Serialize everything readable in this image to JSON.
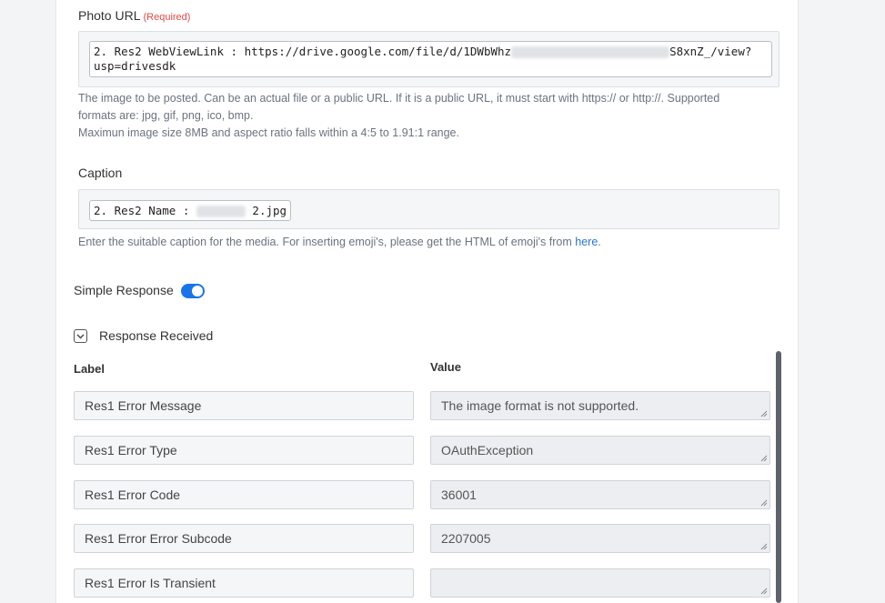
{
  "photo_url": {
    "label": "Photo URL",
    "required": "(Required)",
    "token_line1_a": "2. Res2 WebViewLink : https://drive.google.com/file/d/1DWbWhz",
    "token_line1_b": "S8xnZ_/view?",
    "token_line2": "usp=drivesdk",
    "help_line1": "The image to be posted. Can be an actual file or a public URL. If it is a public URL, it must start with https:// or http://. Supported",
    "help_line2": "formats are: jpg, gif, png, ico, bmp.",
    "help_line3": "Maximun image size 8MB and aspect ratio falls within a 4:5 to 1.91:1 range."
  },
  "caption": {
    "label": "Caption",
    "token_a": "2. Res2 Name :",
    "token_b": "2.jpg",
    "help_text": "Enter the suitable caption for the media. For inserting emoji's, please get the HTML of emoji's from",
    "help_link": "here",
    "help_end": "."
  },
  "simple_response": {
    "label": "Simple Response",
    "enabled": true,
    "accent_color": "#1a73e8"
  },
  "response_received": {
    "label": "Response Received",
    "columns": {
      "label": "Label",
      "value": "Value"
    },
    "rows": [
      {
        "label": "Res1 Error Message",
        "value": "The image format is not supported."
      },
      {
        "label": "Res1 Error Type",
        "value": "OAuthException"
      },
      {
        "label": "Res1 Error Code",
        "value": "36001"
      },
      {
        "label": "Res1 Error Error Subcode",
        "value": "2207005"
      },
      {
        "label": "Res1 Error Is Transient",
        "value": ""
      }
    ]
  }
}
